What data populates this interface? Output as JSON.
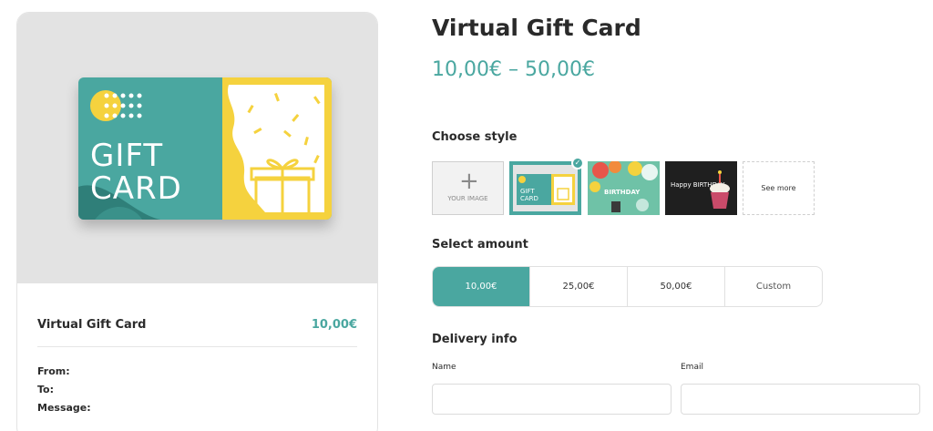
{
  "product": {
    "title": "Virtual Gift Card",
    "price_range": "10,00€ – 50,00€"
  },
  "preview": {
    "card_word_1": "GIFT",
    "card_word_2": "CARD",
    "summary_title": "Virtual Gift Card",
    "summary_price": "10,00€",
    "from_label": "From:",
    "to_label": "To:",
    "message_label": "Message:"
  },
  "style": {
    "label": "Choose style",
    "upload_caption": "YOUR IMAGE",
    "see_more": "See more",
    "thumb_gift_text": "GIFT CARD",
    "thumb_birthday_text": "BIRTHDAY",
    "thumb_cake_text": "Happy BIRTHDAY"
  },
  "amount": {
    "label": "Select amount",
    "options": [
      "10,00€",
      "25,00€",
      "50,00€",
      "Custom"
    ],
    "selected": "10,00€"
  },
  "delivery": {
    "label": "Delivery info",
    "name_label": "Name",
    "email_label": "Email"
  },
  "colors": {
    "accent": "#4aa7a0",
    "gift_yellow": "#f5d23e",
    "preview_bg": "#e3e3e3"
  }
}
